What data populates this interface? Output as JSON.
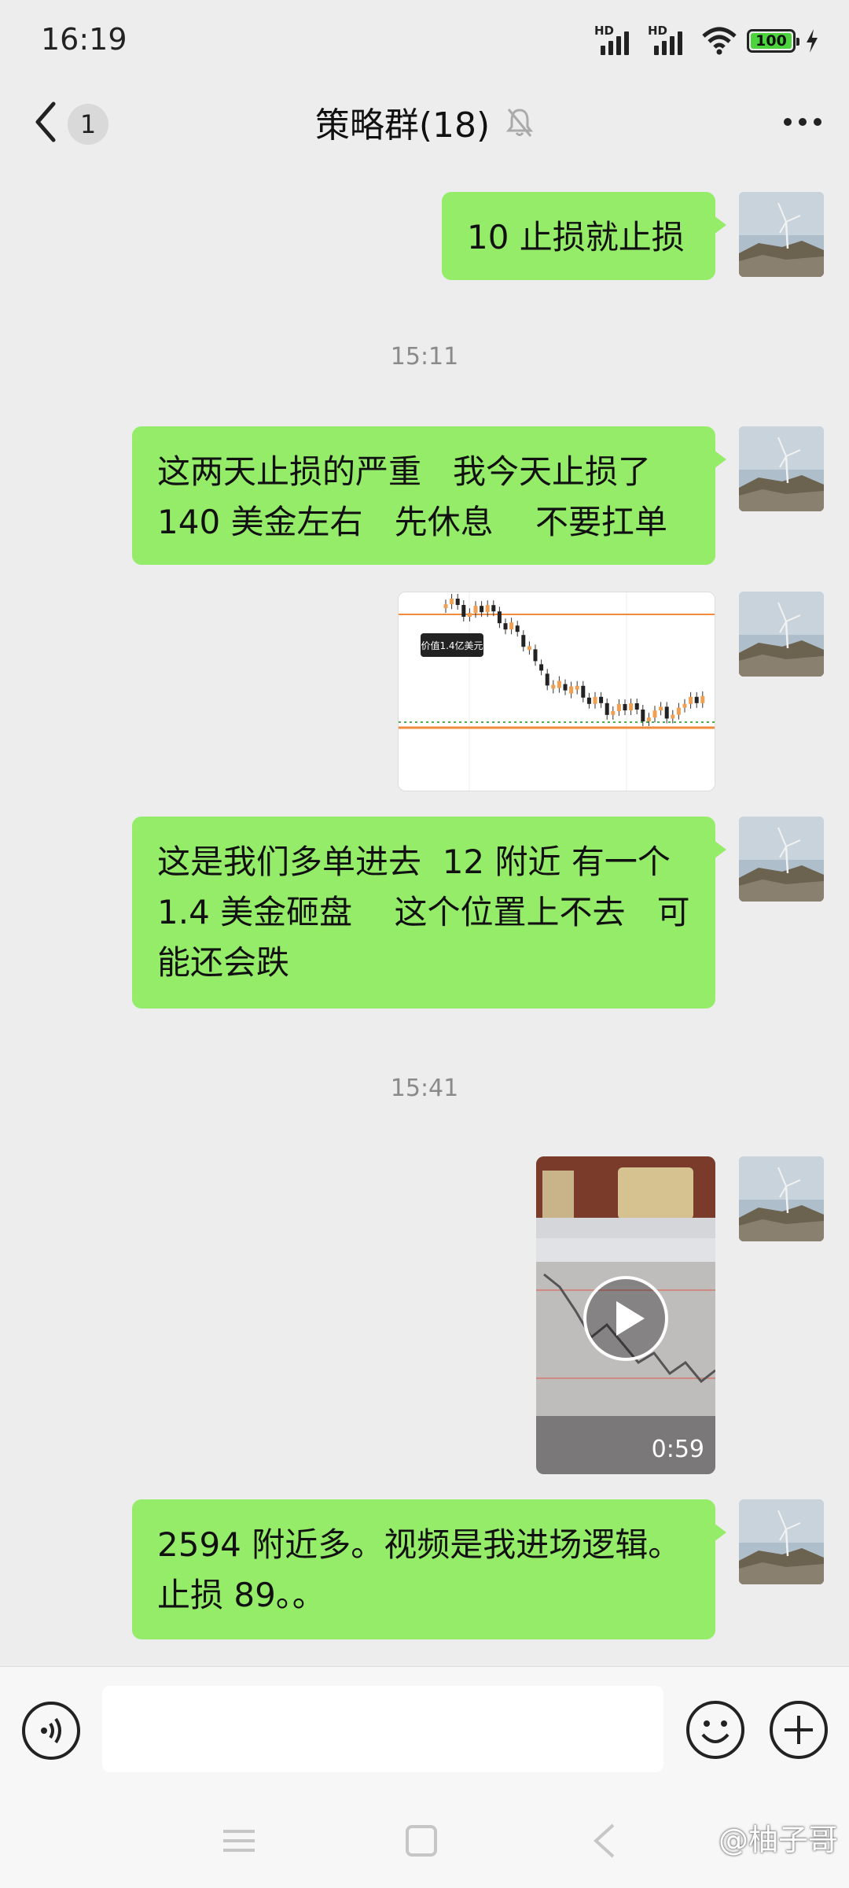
{
  "status_bar": {
    "time": "16:19",
    "signal1_label": "HD",
    "signal2_label": "HD",
    "battery": "100"
  },
  "header": {
    "back_count": "1",
    "title": "策略群(18)"
  },
  "messages": {
    "m1": "10 止损就止损",
    "t1": "15:11",
    "m2": "这两天止损的严重   我今天止损了\n140 美金左右   先休息    不要扛单",
    "m3_image": {
      "chart_tooltip": "价值1.4亿美元"
    },
    "m4": "这是我们多单进去  12 附近 有一个\n1.4 美金砸盘    这个位置上不去   可\n能还会跌",
    "t2": "15:41",
    "m5_video": {
      "duration": "0:59"
    },
    "m6": "2594 附近多。视频是我进场逻辑。\n止损 89。。"
  },
  "input": {
    "placeholder": ""
  },
  "watermark": "@柚子哥",
  "colors": {
    "bubble": "#95ec69",
    "background": "#ededed"
  }
}
